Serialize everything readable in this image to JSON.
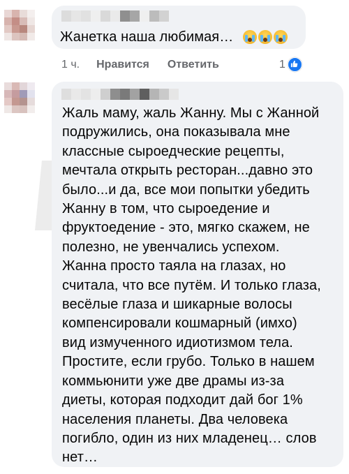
{
  "comments": [
    {
      "text": "Жанетка наша любимая…",
      "emojis": [
        "crying-face-icon",
        "crying-face-icon",
        "crying-face-icon"
      ],
      "meta": {
        "time": "1 ч.",
        "like_label": "Нравится",
        "reply_label": "Ответить",
        "reaction_count": "1"
      }
    },
    {
      "text": "Жаль маму, жаль Жанну. Мы с Жанной\nподружились, она показывала мне\nклассные сыроедческие рецепты,\nмечтала открыть ресторан...давно это\nбыло...и да, все мои попытки убедить\nЖанну в том, что сыроедение и\nфруктоедение - это, мягко скажем, не\nполезно, не увенчались успехом.\nЖанна просто таяла на глазах, но\nсчитала, что все путём. И только глаза,\nвесёлые глаза и шикарные волосы\nкомпенсировали кошмарный (имхо)\nвид измученного идиотизмом тела.\nПростите, если грубо. Только в нашем\nкоммьюнити уже две драмы из-за\nдиеты, которая подходит дай бог 1%\nнаселения планеты. Два человека\nпогибло, один из них младенец… слов\nнет…"
    }
  ],
  "colors": {
    "bubble": "#f0f2f5",
    "text": "#050505",
    "meta": "#65676b",
    "like_blue": "#1877f2"
  }
}
